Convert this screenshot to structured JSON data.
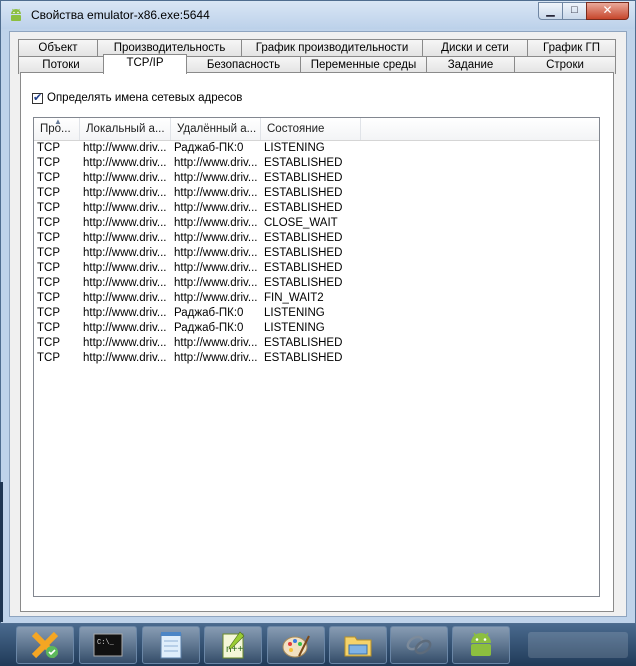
{
  "window": {
    "title": "Свойства emulator-x86.exe:5644",
    "icon": "android-icon",
    "buttons": [
      "minimize-icon",
      "maximize-icon",
      "close-icon"
    ]
  },
  "tabs": {
    "row1": [
      "Объект",
      "Производительность",
      "График производительности",
      "Диски и сети",
      "График ГП"
    ],
    "row2": [
      "Потоки",
      "TCP/IP",
      "Безопасность",
      "Переменные среды",
      "Задание",
      "Строки"
    ],
    "active": "TCP/IP"
  },
  "resolve_checkbox": {
    "label": "Определять имена сетевых адресов",
    "checked": true
  },
  "table": {
    "columns": [
      "Про...",
      "Локальный а...",
      "Удалённый а...",
      "Состояние"
    ],
    "sort_column": "Про...",
    "rows": [
      [
        "TCP",
        "http://www.driv...",
        "Раджаб-ПК:0",
        "LISTENING"
      ],
      [
        "TCP",
        "http://www.driv...",
        "http://www.driv...",
        "ESTABLISHED"
      ],
      [
        "TCP",
        "http://www.driv...",
        "http://www.driv...",
        "ESTABLISHED"
      ],
      [
        "TCP",
        "http://www.driv...",
        "http://www.driv...",
        "ESTABLISHED"
      ],
      [
        "TCP",
        "http://www.driv...",
        "http://www.driv...",
        "ESTABLISHED"
      ],
      [
        "TCP",
        "http://www.driv...",
        "http://www.driv...",
        "CLOSE_WAIT"
      ],
      [
        "TCP",
        "http://www.driv...",
        "http://www.driv...",
        "ESTABLISHED"
      ],
      [
        "TCP",
        "http://www.driv...",
        "http://www.driv...",
        "ESTABLISHED"
      ],
      [
        "TCP",
        "http://www.driv...",
        "http://www.driv...",
        "ESTABLISHED"
      ],
      [
        "TCP",
        "http://www.driv...",
        "http://www.driv...",
        "ESTABLISHED"
      ],
      [
        "TCP",
        "http://www.driv...",
        "http://www.driv...",
        "FIN_WAIT2"
      ],
      [
        "TCP",
        "http://www.driv...",
        "Раджаб-ПК:0",
        "LISTENING"
      ],
      [
        "TCP",
        "http://www.driv...",
        "Раджаб-ПК:0",
        "LISTENING"
      ],
      [
        "TCP",
        "http://www.driv...",
        "http://www.driv...",
        "ESTABLISHED"
      ],
      [
        "TCP",
        "http://www.driv...",
        "http://www.driv...",
        "ESTABLISHED"
      ]
    ]
  },
  "taskbar": {
    "items": [
      "xampp-icon",
      "command-prompt-icon",
      "notepad-icon",
      "notepad-plus-plus-icon",
      "paint-icon",
      "file-explorer-icon",
      "chain-links-icon",
      "android-icon"
    ]
  },
  "colors": {
    "window_frame": "#bfd3ea",
    "taskbar": "#203a58",
    "close_button": "#c7462c"
  }
}
